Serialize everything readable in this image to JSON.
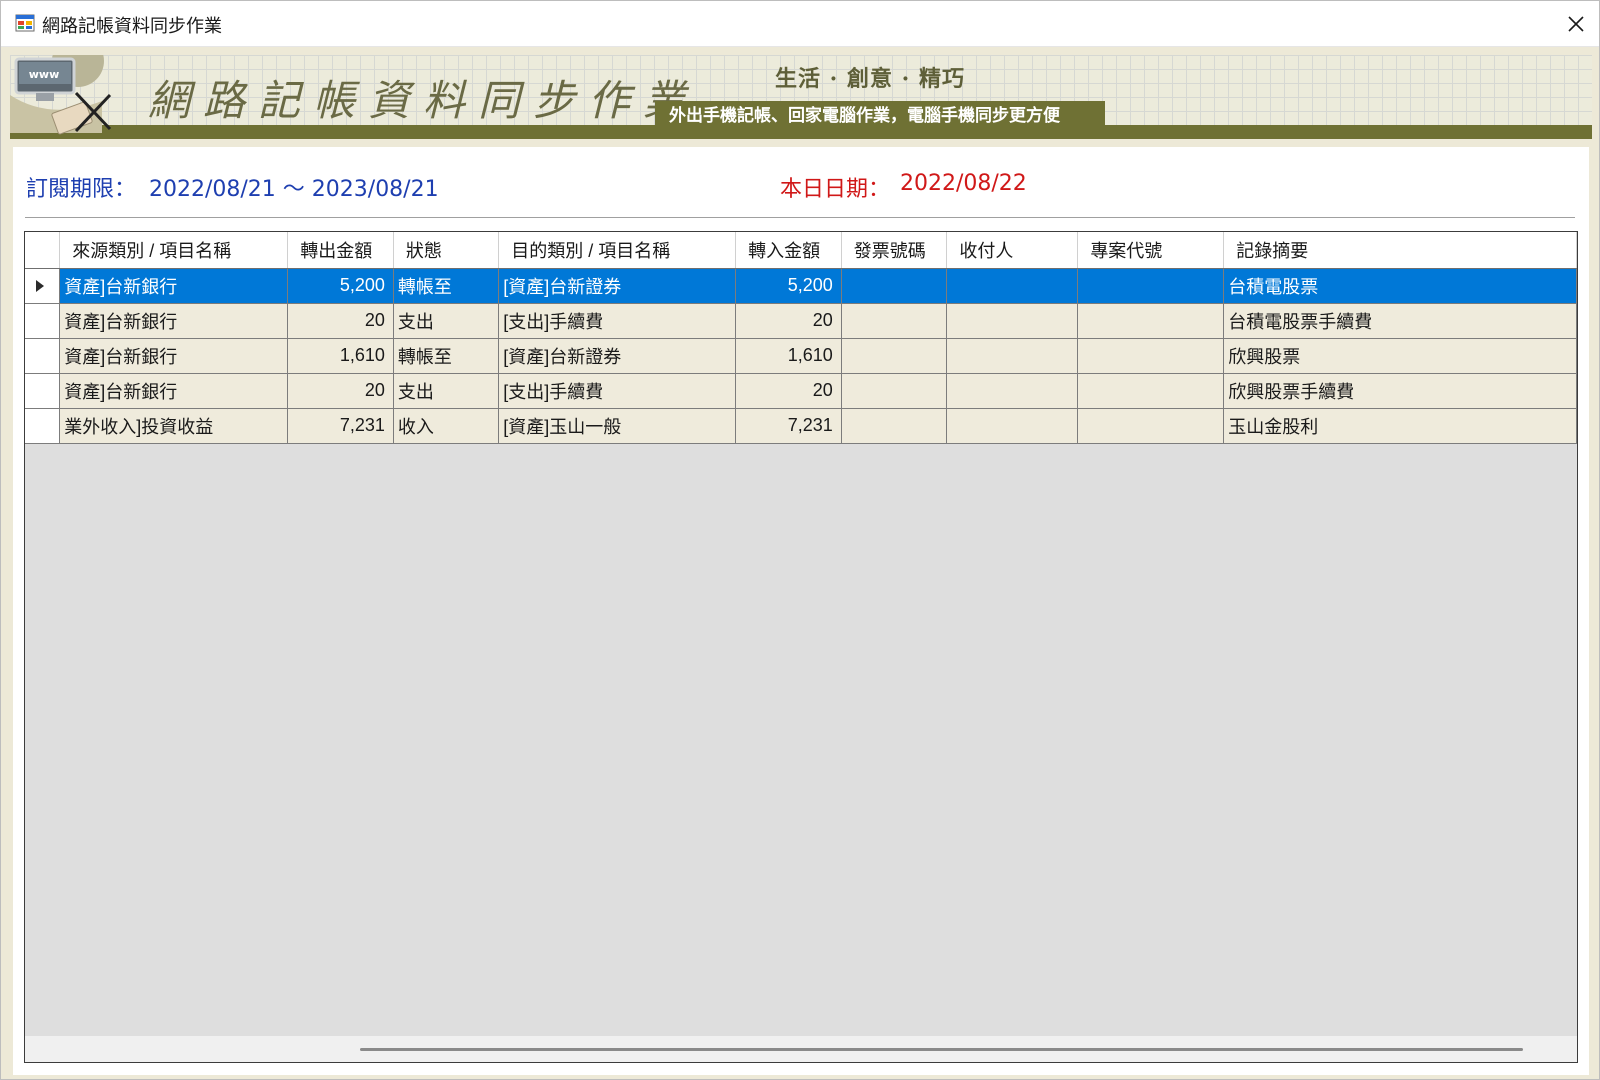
{
  "window": {
    "title": "網路記帳資料同步作業",
    "close_glyph": "✕"
  },
  "banner": {
    "title": "網路記帳資料同步作業",
    "motto": "生活 · 創意 · 精巧",
    "slogan": "外出手機記帳、回家電腦作業，電腦手機同步更方便",
    "art_label": "www"
  },
  "subscription": {
    "label": "訂閱期限：",
    "range": "2022/08/21 ～ 2023/08/21"
  },
  "today": {
    "label": "本日日期：",
    "value": "2022/08/22"
  },
  "grid": {
    "columns": [
      "來源類別 / 項目名稱",
      "轉出金額",
      "狀態",
      "目的類別 / 項目名稱",
      "轉入金額",
      "發票號碼",
      "收付人",
      "專案代號",
      "記錄摘要"
    ],
    "rows": [
      {
        "source": "資產]台新銀行",
        "out_amount": "5,200",
        "status": "轉帳至",
        "target": "[資產]台新證券",
        "in_amount": "5,200",
        "invoice": "",
        "payee": "",
        "project": "",
        "memo": "台積電股票",
        "selected": true
      },
      {
        "source": "資產]台新銀行",
        "out_amount": "20",
        "status": "支出",
        "target": "[支出]手續費",
        "in_amount": "20",
        "invoice": "",
        "payee": "",
        "project": "",
        "memo": "台積電股票手續費",
        "selected": false
      },
      {
        "source": "資產]台新銀行",
        "out_amount": "1,610",
        "status": "轉帳至",
        "target": "[資產]台新證券",
        "in_amount": "1,610",
        "invoice": "",
        "payee": "",
        "project": "",
        "memo": "欣興股票",
        "selected": false
      },
      {
        "source": "資產]台新銀行",
        "out_amount": "20",
        "status": "支出",
        "target": "[支出]手續費",
        "in_amount": "20",
        "invoice": "",
        "payee": "",
        "project": "",
        "memo": "欣興股票手續費",
        "selected": false
      },
      {
        "source": "業外收入]投資收益",
        "out_amount": "7,231",
        "status": "收入",
        "target": "[資產]玉山一般",
        "in_amount": "7,231",
        "invoice": "",
        "payee": "",
        "project": "",
        "memo": "玉山金股利",
        "selected": false
      }
    ]
  },
  "colors": {
    "accent_selected": "#0078d7",
    "period_text": "#1e3fb0",
    "today_text": "#d01818",
    "banner_olive": "#6f7134"
  }
}
